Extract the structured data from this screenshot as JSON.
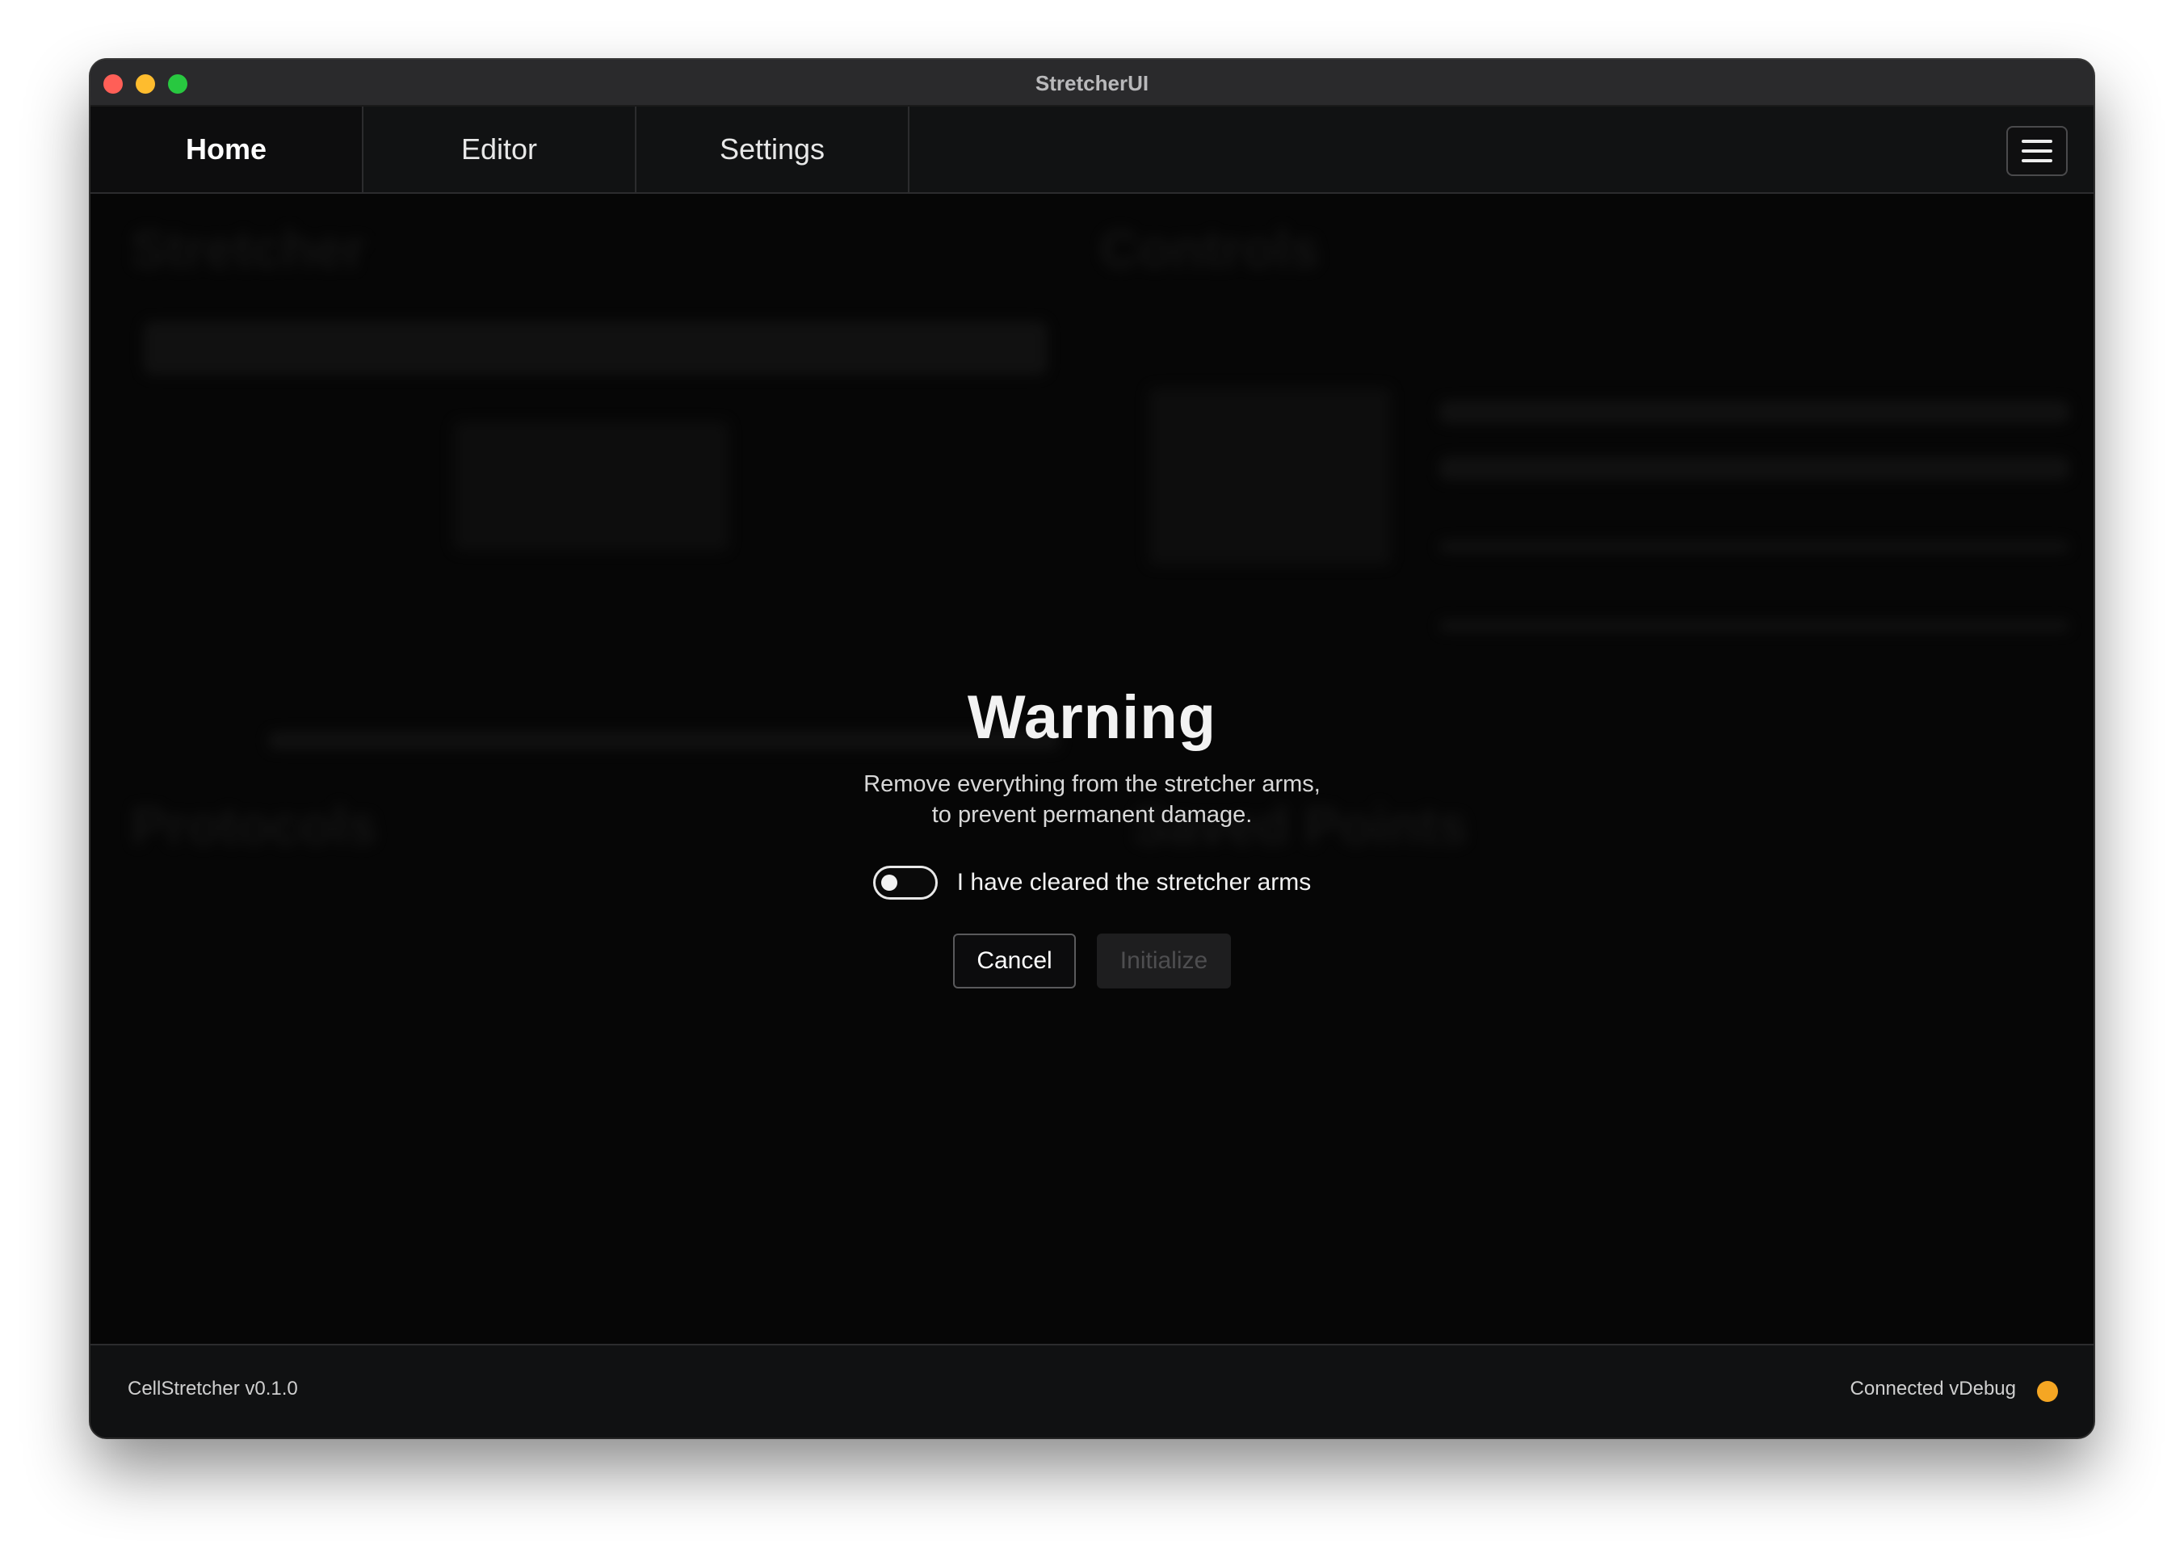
{
  "window": {
    "title": "StretcherUI"
  },
  "tabs": [
    {
      "label": "Home",
      "active": true
    },
    {
      "label": "Editor",
      "active": false
    },
    {
      "label": "Settings",
      "active": false
    }
  ],
  "menu": {
    "icon": "hamburger-menu-icon"
  },
  "dialog": {
    "title": "Warning",
    "message_line1": "Remove everything from the stretcher arms,",
    "message_line2": "to prevent permanent damage.",
    "toggle_label": "I have cleared the stretcher arms",
    "toggle_on": false,
    "cancel_label": "Cancel",
    "initialize_label": "Initialize",
    "initialize_enabled": false
  },
  "background_sections": {
    "stretcher": "Stretcher",
    "controls": "Controls",
    "protocols": "Protocols",
    "saved_points": "Saved Points"
  },
  "footer": {
    "version": "CellStretcher v0.1.0",
    "connection": "Connected vDebug",
    "status_color": "#f5a623"
  }
}
